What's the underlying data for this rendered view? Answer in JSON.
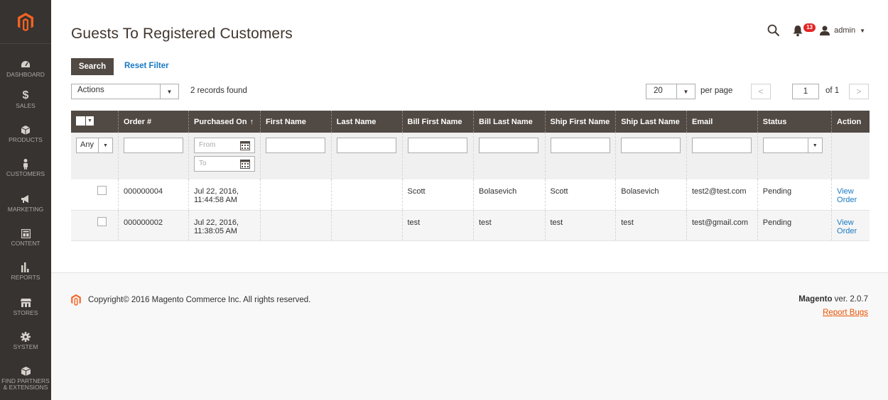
{
  "sidebar": {
    "items": [
      {
        "label": "Dashboard",
        "icon": "dashboard-icon"
      },
      {
        "label": "Sales",
        "icon": "dollar-icon"
      },
      {
        "label": "Products",
        "icon": "box-icon"
      },
      {
        "label": "Customers",
        "icon": "person-icon"
      },
      {
        "label": "Marketing",
        "icon": "megaphone-icon"
      },
      {
        "label": "Content",
        "icon": "layout-icon"
      },
      {
        "label": "Reports",
        "icon": "bar-chart-icon"
      },
      {
        "label": "Stores",
        "icon": "store-icon"
      },
      {
        "label": "System",
        "icon": "gear-icon"
      },
      {
        "label_line1": "Find Partners",
        "label_line2": "& Extensions",
        "icon": "partners-icon"
      }
    ]
  },
  "header": {
    "title": "Guests To Registered Customers",
    "notifications_count": "13",
    "user_name": "admin"
  },
  "toolbar": {
    "search_label": "Search",
    "reset_filter_label": "Reset Filter",
    "actions_value": "Actions",
    "records_found": "2 records found",
    "per_page_value": "20",
    "per_page_label": "per page",
    "page_value": "1",
    "page_of": "of 1"
  },
  "grid": {
    "columns": [
      "Order #",
      "Purchased On",
      "First Name",
      "Last Name",
      "Bill First Name",
      "Bill Last Name",
      "Ship First Name",
      "Ship Last Name",
      "Email",
      "Status",
      "Action"
    ],
    "filter_any": "Any",
    "date_from_placeholder": "From",
    "date_to_placeholder": "To",
    "rows": [
      {
        "order": "000000004",
        "purchased_line1": "Jul 22, 2016,",
        "purchased_line2": "11:44:58 AM",
        "first_name": "",
        "last_name": "",
        "bill_first": "Scott",
        "bill_last": "Bolasevich",
        "ship_first": "Scott",
        "ship_last": "Bolasevich",
        "email": "test2@test.com",
        "status": "Pending",
        "action_line1": "View",
        "action_line2": "Order"
      },
      {
        "order": "000000002",
        "purchased_line1": "Jul 22, 2016,",
        "purchased_line2": "11:38:05 AM",
        "first_name": "",
        "last_name": "",
        "bill_first": "test",
        "bill_last": "test",
        "ship_first": "test",
        "ship_last": "test",
        "email": "test@gmail.com",
        "status": "Pending",
        "action_line1": "View",
        "action_line2": "Order"
      }
    ]
  },
  "footer": {
    "copyright": "Copyright© 2016 Magento Commerce Inc. All rights reserved.",
    "brand": "Magento",
    "version": " ver. 2.0.7",
    "report_bugs": "Report Bugs"
  },
  "colors": {
    "sidebar_bg": "#373330",
    "header_bg": "#514943",
    "brand_orange": "#eb5202",
    "link_blue": "#1979c3"
  }
}
